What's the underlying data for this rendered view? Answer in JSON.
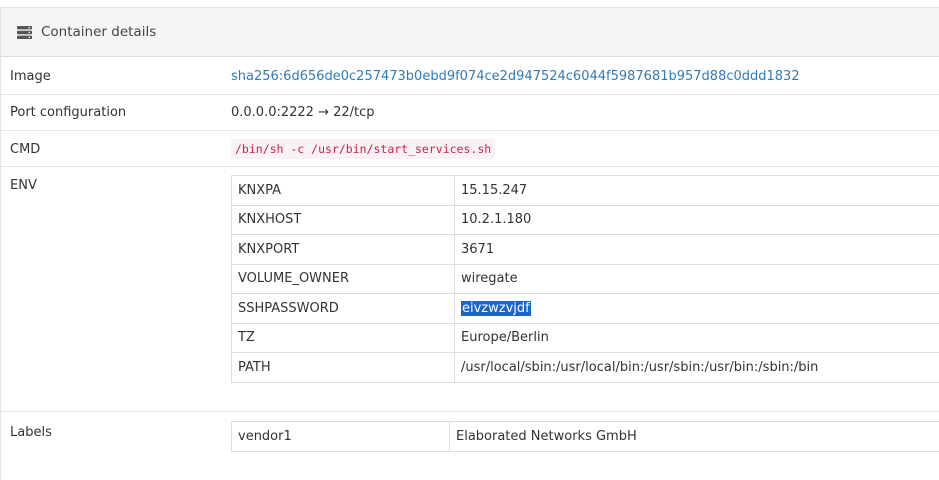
{
  "panel": {
    "title": "Container details",
    "icon": "server-icon"
  },
  "image": {
    "label": "Image",
    "value": "sha256:6d656de0c257473b0ebd9f074ce2d947524c6044f5987681b957d88c0ddd1832"
  },
  "port": {
    "label": "Port configuration",
    "value": "0.0.0.0:2222 → 22/tcp"
  },
  "cmd": {
    "label": "CMD",
    "value": "/bin/sh -c /usr/bin/start_services.sh"
  },
  "env": {
    "label": "ENV",
    "rows": [
      {
        "key": "KNXPA",
        "value": "15.15.247"
      },
      {
        "key": "KNXHOST",
        "value": "10.2.1.180"
      },
      {
        "key": "KNXPORT",
        "value": "3671"
      },
      {
        "key": "VOLUME_OWNER",
        "value": "wiregate"
      },
      {
        "key": "SSHPASSWORD",
        "value": "eivzwzvjdf"
      },
      {
        "key": "TZ",
        "value": "Europe/Berlin"
      },
      {
        "key": "PATH",
        "value": "/usr/local/sbin:/usr/local/bin:/usr/sbin:/usr/bin:/sbin:/bin"
      }
    ]
  },
  "labels": {
    "label": "Labels",
    "rows": [
      {
        "key": "vendor1",
        "value": "Elaborated Networks GmbH"
      }
    ]
  },
  "colors": {
    "link": "#337ab7",
    "code": "#c7254e",
    "selection": "#1a67c9"
  }
}
